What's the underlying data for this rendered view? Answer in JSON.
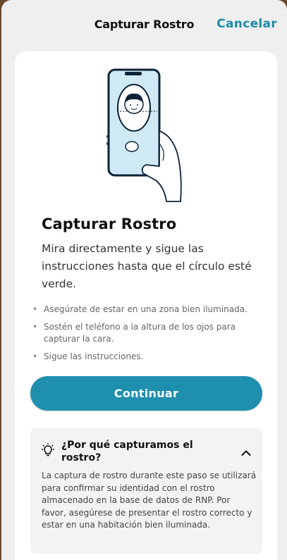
{
  "nav": {
    "title": "Capturar Rostro",
    "cancel_label": "Cancelar"
  },
  "colors": {
    "accent": "#1f8fae",
    "cancel": "#1a8aa8",
    "phone_screen": "#cfe9f5"
  },
  "main": {
    "heading": "Capturar Rostro",
    "lead": "Mira directamente y sigue las instrucciones hasta que el círculo esté verde.",
    "bullets": [
      "Asegúrate de estar en una zona bien iluminada.",
      "Sostén el teléfono a la altura de los ojos para capturar la cara.",
      "Sigue las instrucciones."
    ],
    "continue_label": "Continuar"
  },
  "faq": {
    "icon": "lightbulb-icon",
    "title": "¿Por qué capturamos el rostro?",
    "body": "La captura de rostro durante este paso se utilizará para confirmar su identidad con el rostro almacenado en la base de datos de RNP. Por favor, asegúrese de presentar el rostro correcto y estar en una habitación bien iluminada."
  }
}
